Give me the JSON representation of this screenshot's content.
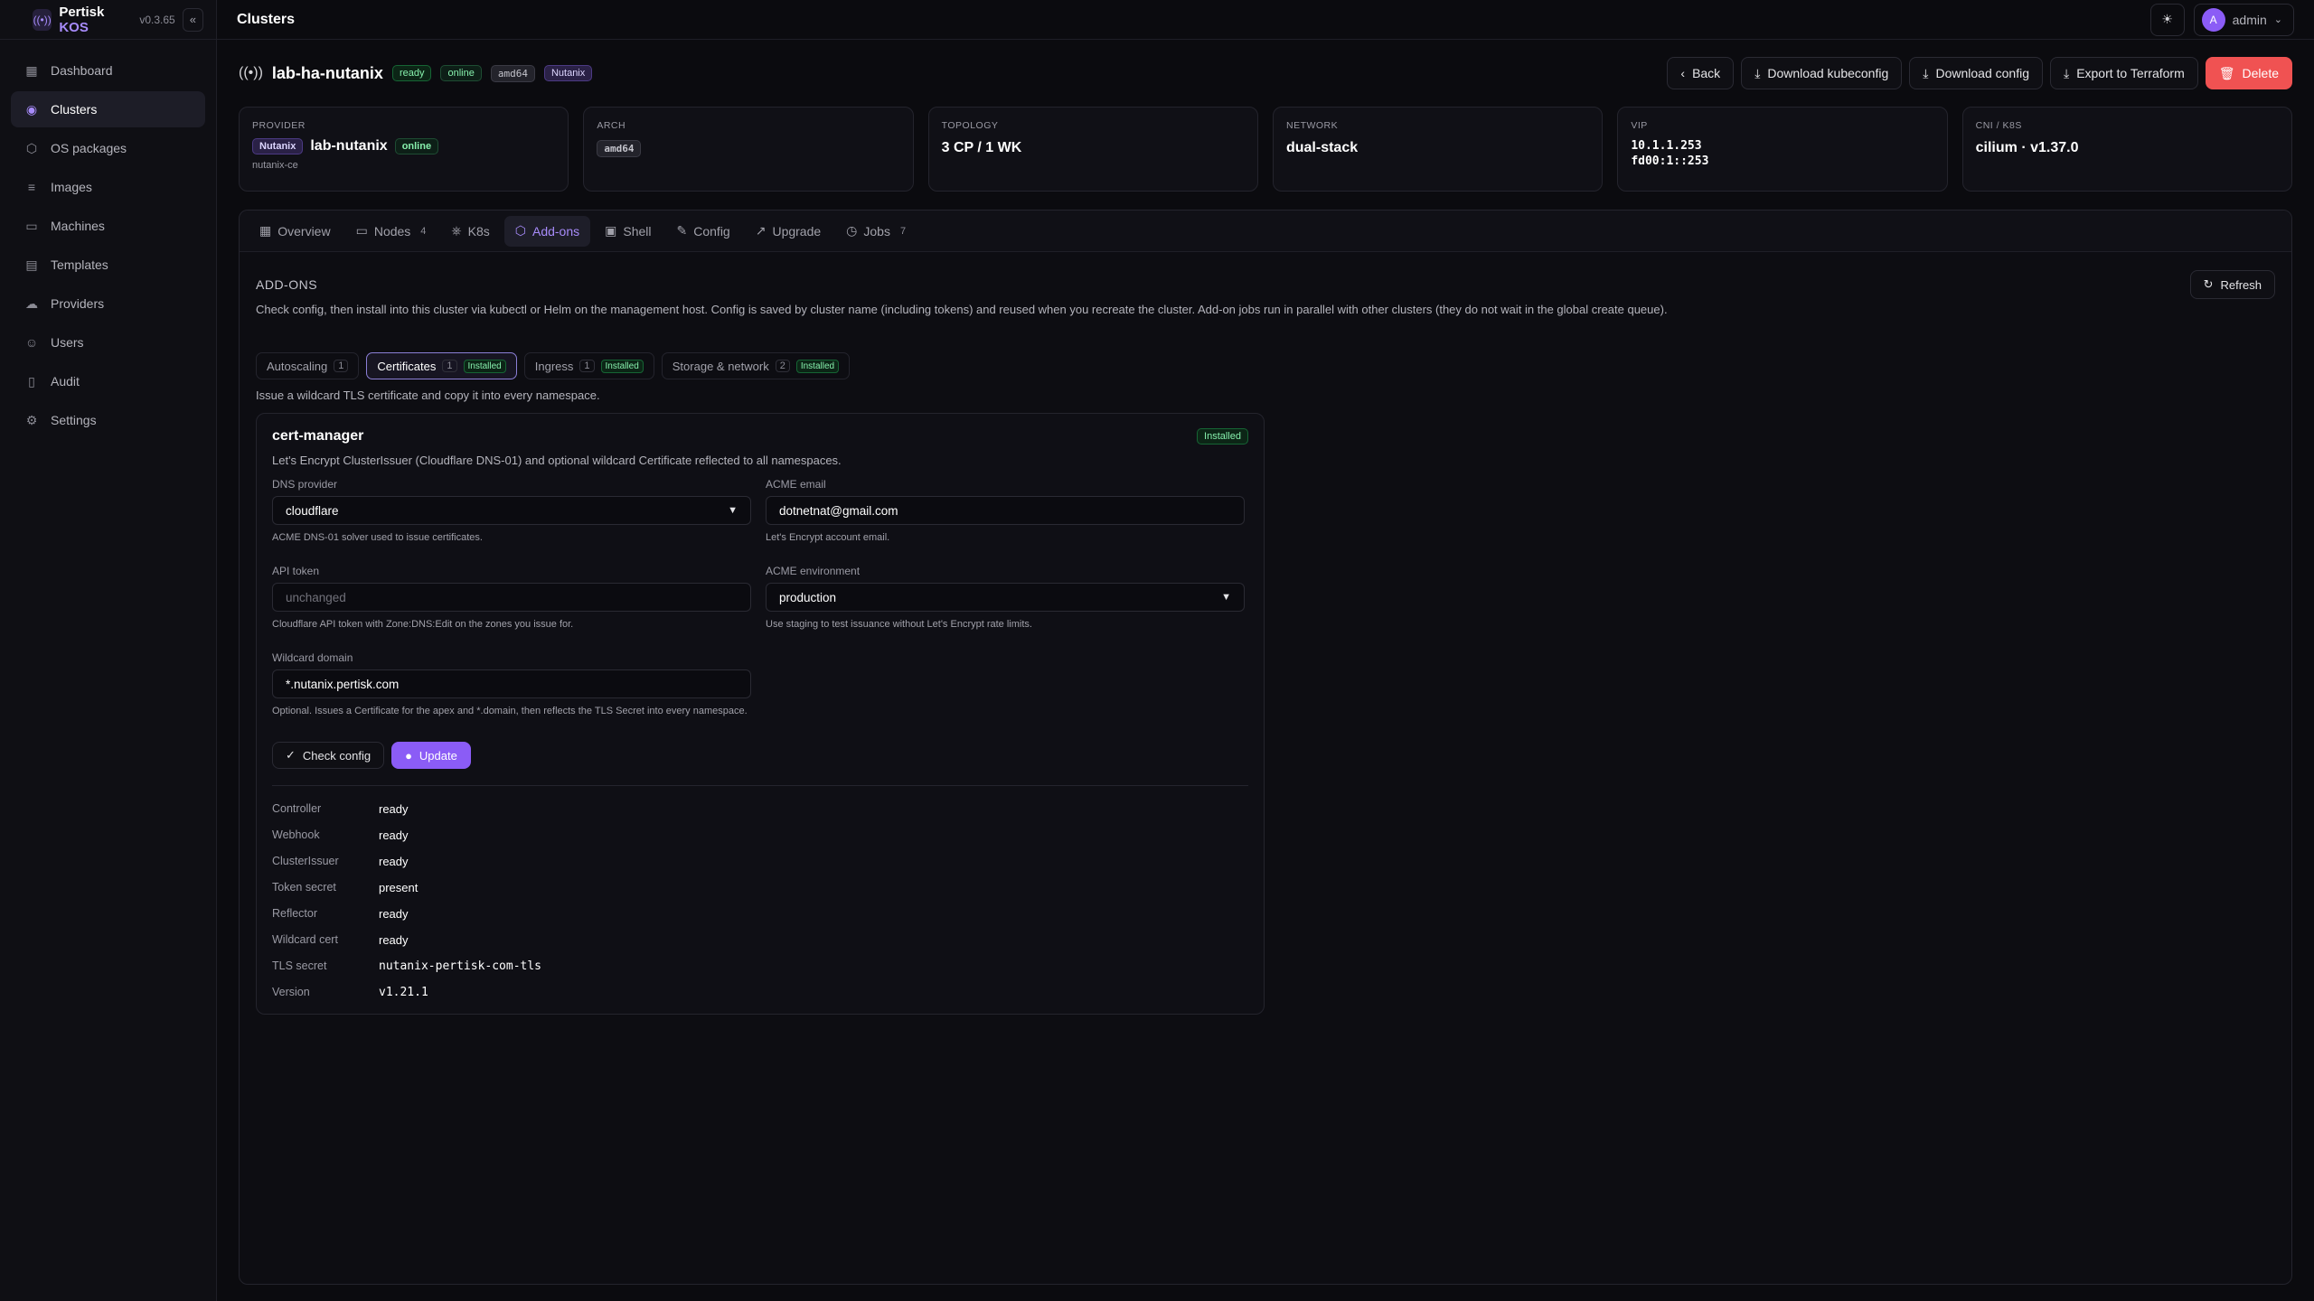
{
  "app": {
    "name_primary": "Pertisk",
    "name_accent": "KOS",
    "version": "v0.3.65"
  },
  "sidebar": {
    "items": [
      {
        "label": "Dashboard",
        "icon": "grid-icon"
      },
      {
        "label": "Clusters",
        "icon": "signal-icon"
      },
      {
        "label": "OS packages",
        "icon": "box-icon"
      },
      {
        "label": "Images",
        "icon": "database-icon"
      },
      {
        "label": "Machines",
        "icon": "monitor-icon"
      },
      {
        "label": "Templates",
        "icon": "layout-icon"
      },
      {
        "label": "Providers",
        "icon": "cloud-icon"
      },
      {
        "label": "Users",
        "icon": "users-icon"
      },
      {
        "label": "Audit",
        "icon": "clipboard-icon"
      },
      {
        "label": "Settings",
        "icon": "gear-icon"
      }
    ],
    "active": "Clusters"
  },
  "topbar": {
    "title": "Clusters",
    "user_initial": "A",
    "user_name": "admin"
  },
  "cluster": {
    "name": "lab-ha-nutanix",
    "badges": [
      "ready",
      "online",
      "amd64",
      "Nutanix"
    ]
  },
  "actions": {
    "back": "Back",
    "kubeconfig": "Download kubeconfig",
    "config": "Download config",
    "terraform": "Export to Terraform",
    "delete": "Delete"
  },
  "cards": {
    "provider": {
      "label": "Provider",
      "tag": "Nutanix",
      "name": "lab-nutanix",
      "status": "online",
      "sub": "nutanix-ce"
    },
    "arch": {
      "label": "Arch",
      "value": "amd64"
    },
    "topology": {
      "label": "Topology",
      "value": "3 CP / 1 WK"
    },
    "network": {
      "label": "Network",
      "value": "dual-stack"
    },
    "vip": {
      "label": "VIP",
      "v4": "10.1.1.253",
      "v6": "fd00:1::253"
    },
    "cni": {
      "label": "CNI / K8s",
      "value": "cilium · v1.37.0"
    }
  },
  "tabs": [
    {
      "label": "Overview",
      "count": ""
    },
    {
      "label": "Nodes",
      "count": "4"
    },
    {
      "label": "K8s",
      "count": ""
    },
    {
      "label": "Add-ons",
      "count": ""
    },
    {
      "label": "Shell",
      "count": ""
    },
    {
      "label": "Config",
      "count": ""
    },
    {
      "label": "Upgrade",
      "count": ""
    },
    {
      "label": "Jobs",
      "count": "7"
    }
  ],
  "addons": {
    "title": "Add-ons",
    "refresh": "Refresh",
    "description": "Check config, then install into this cluster via kubectl or Helm on the management host. Config is saved by cluster name (including tokens) and reused when you recreate the cluster. Add-on jobs run in parallel with other clusters (they do not wait in the global create queue).",
    "subtabs": [
      {
        "label": "Autoscaling",
        "count": "1",
        "installed": ""
      },
      {
        "label": "Certificates",
        "count": "1",
        "installed": "Installed"
      },
      {
        "label": "Ingress",
        "count": "1",
        "installed": "Installed"
      },
      {
        "label": "Storage & network",
        "count": "2",
        "installed": "Installed"
      }
    ],
    "hint": "Issue a wildcard TLS certificate and copy it into every namespace.",
    "card": {
      "name": "cert-manager",
      "badge": "Installed",
      "desc": "Let's Encrypt ClusterIssuer (Cloudflare DNS-01) and optional wildcard Certificate reflected to all namespaces.",
      "dns_label": "DNS provider",
      "dns_value": "cloudflare",
      "dns_help": "ACME DNS-01 solver used to issue certificates.",
      "email_label": "ACME email",
      "email_value": "dotnetnat@gmail.com",
      "email_help": "Let's Encrypt account email.",
      "token_label": "API token",
      "token_placeholder": "unchanged",
      "token_help": "Cloudflare API token with Zone:DNS:Edit on the zones you issue for.",
      "env_label": "ACME environment",
      "env_value": "production",
      "env_help": "Use staging to test issuance without Let's Encrypt rate limits.",
      "domain_label": "Wildcard domain",
      "domain_value": "*.nutanix.pertisk.com",
      "domain_help": "Optional. Issues a Certificate for the apex and *.domain, then reflects the TLS Secret into every namespace.",
      "check": "Check config",
      "update": "Update",
      "status": [
        {
          "k": "Controller",
          "v": "ready"
        },
        {
          "k": "Webhook",
          "v": "ready"
        },
        {
          "k": "ClusterIssuer",
          "v": "ready"
        },
        {
          "k": "Token secret",
          "v": "present"
        },
        {
          "k": "Reflector",
          "v": "ready"
        },
        {
          "k": "Wildcard cert",
          "v": "ready"
        },
        {
          "k": "TLS secret",
          "v": "nutanix-pertisk-com-tls"
        },
        {
          "k": "Version",
          "v": "v1.21.1"
        }
      ]
    }
  }
}
